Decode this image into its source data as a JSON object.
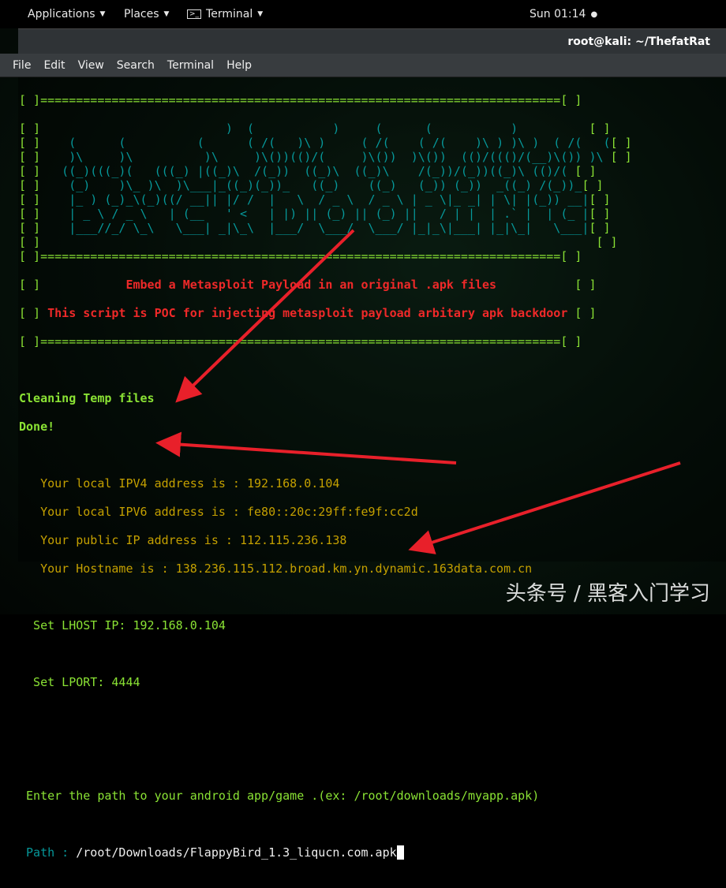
{
  "topbar": {
    "applications": "Applications",
    "places": "Places",
    "terminal": "Terminal",
    "clock": "Sun 01:14"
  },
  "window": {
    "title": "root@kali: ~/ThefatRat"
  },
  "menu": [
    "File",
    "Edit",
    "View",
    "Search",
    "Terminal",
    "Help"
  ],
  "banner": {
    "border": "[ ]=========================================================================[ ]",
    "bracket": "[ ]",
    "art": [
      "                          )  (           )     (      (           )          ",
      "    (      (          (      ( /(   )\\ )     ( /(    ( /(    )\\ ) )\\ )  ( /(   (",
      "    )\\     )\\          )\\     )\\())(()/(     )\\())  )\\())  (()/((()/(__)\\()) )\\ ",
      "   ((_)(((_)(   (((_) |((_)\\  /(_))  ((_)\\  ((_)\\    /(_))/(_))((_)\\ (()/( ",
      "    (_)    )\\_ )\\  )\\___|_((_)(_))_   ((_)    ((_)   (_)) (_))  _((_) /(_))_",
      "    |_ ) (_)_\\(_)((/ __|| |/ /  |   \\  / _ \\  / _ \\ | _ \\|_ _| | \\| |(_)) __|",
      "    | _ \\ / _ \\   | (__   ' <   | |) || (_) || (_) ||   / | |  | .` |  | (_ |",
      "    |___//_/ \\_\\   \\___| _|\\_\\  |___/  \\___/  \\___/ |_|_\\|___| |_|\\_|   \\___|",
      "                                                                              "
    ],
    "line1": "            Embed a Metasploit Payload in an original .apk files           ",
    "line2": " This script is POC for injecting metasploit payload arbitary apk backdoor "
  },
  "output": {
    "cleaning": "Cleaning Temp files",
    "done": "Done!",
    "ipv4": "   Your local IPV4 address is : 192.168.0.104",
    "ipv6": "   Your local IPV6 address is : fe80::20c:29ff:fe9f:cc2d",
    "public": "   Your public IP address is : 112.115.236.138",
    "hostname": "   Your Hostname is : 138.236.115.112.broad.km.yn.dynamic.163data.com.cn",
    "lhost": "  Set LHOST IP: 192.168.0.104",
    "lport": "  Set LPORT: 4444",
    "enter": " Enter the path to your android app/game .(ex: /root/downloads/myapp.apk)",
    "path_label": " Path : ",
    "path_value": "/root/Downloads/FlappyBird_1.3_liqucn.com.apk"
  },
  "watermark": "头条号 / 黑客入门学习",
  "colors": {
    "arrow": "#e8202a",
    "green": "#8ae234",
    "cyan": "#06989a",
    "red": "#ef2929",
    "yellow": "#c4a000"
  }
}
